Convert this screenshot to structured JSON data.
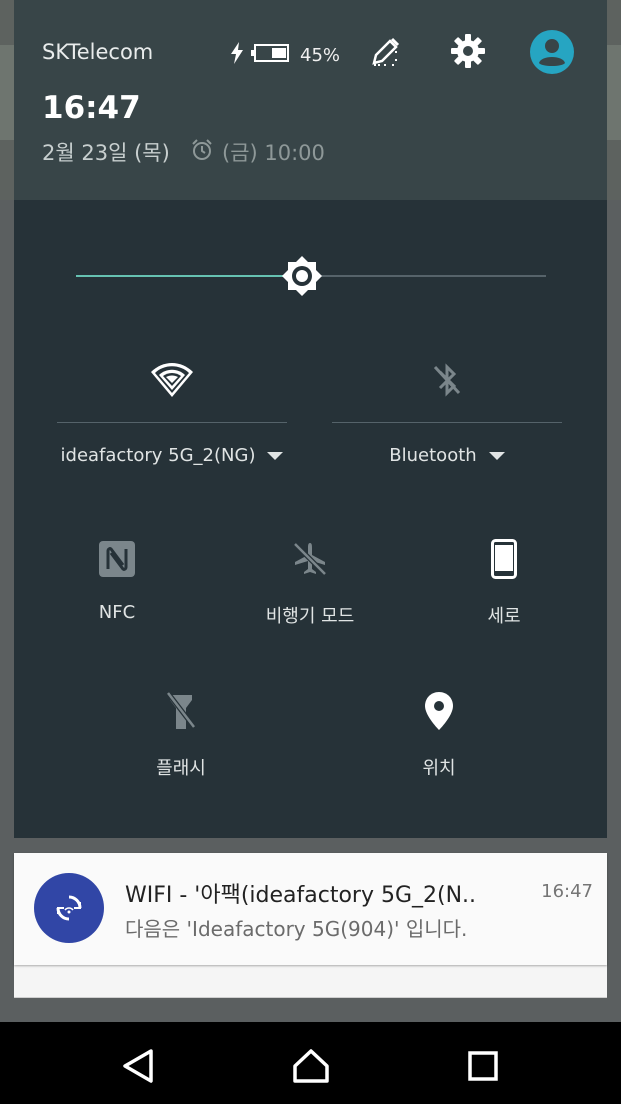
{
  "status": {
    "carrier": "SKTelecom",
    "battery_percent": "45%",
    "time": "16:47",
    "date": "2월 23일 (목)",
    "next_alarm": "(금) 10:00"
  },
  "icons": {
    "charging": "bolt-icon",
    "battery": "battery-icon",
    "edit": "edit-icon",
    "settings": "gear-icon",
    "user": "account-icon"
  },
  "brightness": {
    "level": 0.48
  },
  "tiles": {
    "wifi": {
      "label": "ideafactory 5G_2(NG)",
      "state": "on"
    },
    "bluetooth": {
      "label": "Bluetooth",
      "state": "off"
    },
    "nfc": {
      "label": "NFC",
      "state": "off"
    },
    "airplane": {
      "label": "비행기 모드",
      "state": "off"
    },
    "rotation": {
      "label": "세로",
      "state": "on"
    },
    "flashlight": {
      "label": "플래시",
      "state": "off"
    },
    "location": {
      "label": "위치",
      "state": "on"
    }
  },
  "notification": {
    "title": "WIFI - '아팩(ideafactory 5G_2(N..",
    "text": "다음은 'Ideafactory 5G(904)' 입니다.",
    "time": "16:47"
  },
  "colors": {
    "accent": "#66c2b2",
    "header_bg": "#384548",
    "panel_bg": "#263238",
    "notification_icon_bg": "#3146a6",
    "avatar": "#26a5c2"
  }
}
